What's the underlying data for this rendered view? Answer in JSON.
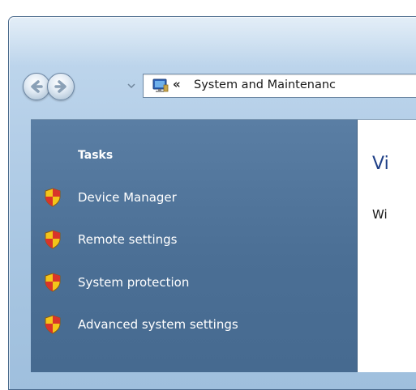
{
  "address_bar": {
    "separator": "«",
    "breadcrumb": "System and Maintenanc"
  },
  "sidebar": {
    "heading": "Tasks",
    "items": [
      {
        "label": "Device Manager"
      },
      {
        "label": "Remote settings"
      },
      {
        "label": "System protection"
      },
      {
        "label": "Advanced system settings"
      }
    ]
  },
  "main": {
    "heading": "Vi",
    "text": "Wi"
  },
  "colors": {
    "sidebar_bg": "#4b6f95",
    "heading_blue": "#1e3f87",
    "shield_red": "#d8342a",
    "shield_yellow": "#f3c51a"
  },
  "icons": {
    "back": "back-arrow-icon",
    "forward": "forward-arrow-icon",
    "history": "chevron-down-icon",
    "address": "computer-monitor-icon",
    "task": "uac-shield-icon"
  }
}
